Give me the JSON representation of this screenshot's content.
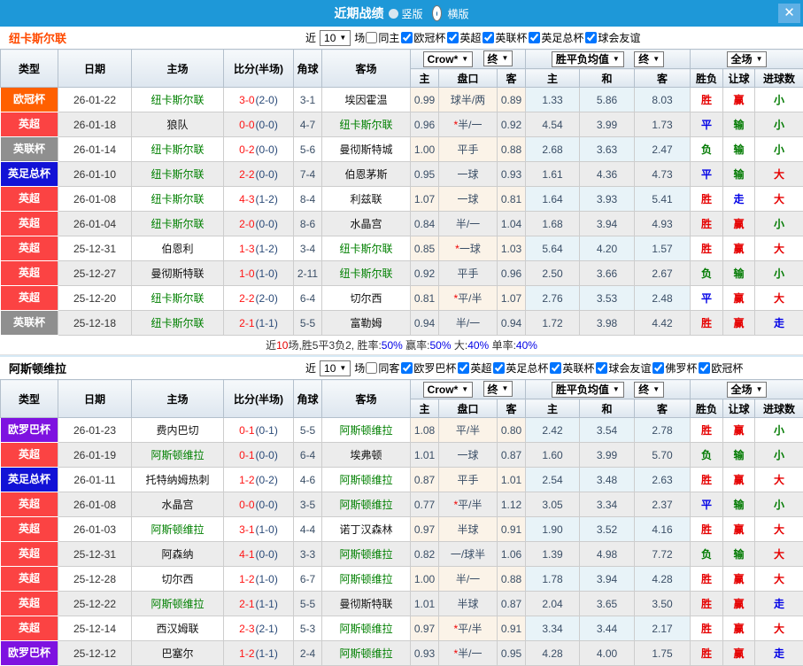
{
  "titlebar": {
    "title": "近期战绩",
    "radio_vertical": "竖版",
    "radio_horizontal": "横版",
    "close": "✕"
  },
  "header": {
    "cols": [
      "类型",
      "日期",
      "主场",
      "比分(半场)",
      "角球",
      "客场"
    ],
    "sub": [
      "主",
      "盘口",
      "客",
      "主",
      "和",
      "客",
      "胜负",
      "让球",
      "进球数"
    ],
    "selects": {
      "bookmaker": "Crow*",
      "final_a": "终",
      "avg": "胜平负均值",
      "final_b": "终",
      "scope": "全场"
    }
  },
  "colors": {
    "titlebar_blue": "#1E98D8",
    "badge_orange": "#FF6000",
    "badge_red": "#FB4343",
    "badge_gray": "#8F8F8F",
    "badge_blue": "#1212D6",
    "badge_purple": "#7E12E0",
    "highlight_team_green": "#008000",
    "score_red": "#FF1414",
    "half_score_navy": "#2A4A78",
    "win_red": "#E60000",
    "draw_blue": "#0000E6",
    "lose_green": "#007A00"
  },
  "sections": [
    {
      "team": "纽卡斯尔联",
      "team_color": "#FF4A00",
      "filters": {
        "near": "近",
        "count": "10",
        "games": "场",
        "same": "同主",
        "same_checked": false,
        "leagues": [
          "欧冠杯",
          "英超",
          "英联杯",
          "英足总杯",
          "球会友谊"
        ]
      },
      "rows": [
        {
          "comp": "欧冠杯",
          "badge": "orange",
          "date": "26-01-22",
          "home": "纽卡斯尔联",
          "hh": true,
          "score": "3-0",
          "half": "(2-0)",
          "corner": "3-1",
          "away": "埃因霍温",
          "ah": false,
          "w1": "0.99",
          "pk": "球半/两",
          "star": false,
          "w2": "0.89",
          "m1": "1.33",
          "m2": "5.86",
          "m3": "8.03",
          "r1": "胜",
          "c1": "r",
          "r2": "赢",
          "c2": "r",
          "r3": "小",
          "c3": "g"
        },
        {
          "comp": "英超",
          "badge": "red",
          "date": "26-01-18",
          "home": "狼队",
          "hh": false,
          "score": "0-0",
          "half": "(0-0)",
          "corner": "4-7",
          "away": "纽卡斯尔联",
          "ah": true,
          "w1": "0.96",
          "pk": "半/一",
          "star": true,
          "w2": "0.92",
          "m1": "4.54",
          "m2": "3.99",
          "m3": "1.73",
          "r1": "平",
          "c1": "b",
          "r2": "输",
          "c2": "g",
          "r3": "小",
          "c3": "g"
        },
        {
          "comp": "英联杯",
          "badge": "gray",
          "date": "26-01-14",
          "home": "纽卡斯尔联",
          "hh": true,
          "score": "0-2",
          "half": "(0-0)",
          "corner": "5-6",
          "away": "曼彻斯特城",
          "ah": false,
          "w1": "1.00",
          "pk": "平手",
          "star": false,
          "w2": "0.88",
          "m1": "2.68",
          "m2": "3.63",
          "m3": "2.47",
          "r1": "负",
          "c1": "g",
          "r2": "输",
          "c2": "g",
          "r3": "小",
          "c3": "g"
        },
        {
          "comp": "英足总杯",
          "badge": "blue",
          "date": "26-01-10",
          "home": "纽卡斯尔联",
          "hh": true,
          "score": "2-2",
          "half": "(0-0)",
          "corner": "7-4",
          "away": "伯恩茅斯",
          "ah": false,
          "w1": "0.95",
          "pk": "一球",
          "star": false,
          "w2": "0.93",
          "m1": "1.61",
          "m2": "4.36",
          "m3": "4.73",
          "r1": "平",
          "c1": "b",
          "r2": "输",
          "c2": "g",
          "r3": "大",
          "c3": "r"
        },
        {
          "comp": "英超",
          "badge": "red",
          "date": "26-01-08",
          "home": "纽卡斯尔联",
          "hh": true,
          "score": "4-3",
          "half": "(1-2)",
          "corner": "8-4",
          "away": "利兹联",
          "ah": false,
          "w1": "1.07",
          "pk": "一球",
          "star": false,
          "w2": "0.81",
          "m1": "1.64",
          "m2": "3.93",
          "m3": "5.41",
          "r1": "胜",
          "c1": "r",
          "r2": "走",
          "c2": "b",
          "r3": "大",
          "c3": "r"
        },
        {
          "comp": "英超",
          "badge": "red",
          "date": "26-01-04",
          "home": "纽卡斯尔联",
          "hh": true,
          "score": "2-0",
          "half": "(0-0)",
          "corner": "8-6",
          "away": "水晶宫",
          "ah": false,
          "w1": "0.84",
          "pk": "半/一",
          "star": false,
          "w2": "1.04",
          "m1": "1.68",
          "m2": "3.94",
          "m3": "4.93",
          "r1": "胜",
          "c1": "r",
          "r2": "赢",
          "c2": "r",
          "r3": "小",
          "c3": "g"
        },
        {
          "comp": "英超",
          "badge": "red",
          "date": "25-12-31",
          "home": "伯恩利",
          "hh": false,
          "score": "1-3",
          "half": "(1-2)",
          "corner": "3-4",
          "away": "纽卡斯尔联",
          "ah": true,
          "w1": "0.85",
          "pk": "一球",
          "star": true,
          "w2": "1.03",
          "m1": "5.64",
          "m2": "4.20",
          "m3": "1.57",
          "r1": "胜",
          "c1": "r",
          "r2": "赢",
          "c2": "r",
          "r3": "大",
          "c3": "r"
        },
        {
          "comp": "英超",
          "badge": "red",
          "date": "25-12-27",
          "home": "曼彻斯特联",
          "hh": false,
          "score": "1-0",
          "half": "(1-0)",
          "corner": "2-11",
          "away": "纽卡斯尔联",
          "ah": true,
          "w1": "0.92",
          "pk": "平手",
          "star": false,
          "w2": "0.96",
          "m1": "2.50",
          "m2": "3.66",
          "m3": "2.67",
          "r1": "负",
          "c1": "g",
          "r2": "输",
          "c2": "g",
          "r3": "小",
          "c3": "g"
        },
        {
          "comp": "英超",
          "badge": "red",
          "date": "25-12-20",
          "home": "纽卡斯尔联",
          "hh": true,
          "score": "2-2",
          "half": "(2-0)",
          "corner": "6-4",
          "away": "切尔西",
          "ah": false,
          "w1": "0.81",
          "pk": "平/半",
          "star": true,
          "w2": "1.07",
          "m1": "2.76",
          "m2": "3.53",
          "m3": "2.48",
          "r1": "平",
          "c1": "b",
          "r2": "赢",
          "c2": "r",
          "r3": "大",
          "c3": "r"
        },
        {
          "comp": "英联杯",
          "badge": "gray",
          "date": "25-12-18",
          "home": "纽卡斯尔联",
          "hh": true,
          "score": "2-1",
          "half": "(1-1)",
          "corner": "5-5",
          "away": "富勒姆",
          "ah": false,
          "w1": "0.94",
          "pk": "半/一",
          "star": false,
          "w2": "0.94",
          "m1": "1.72",
          "m2": "3.98",
          "m3": "4.42",
          "r1": "胜",
          "c1": "r",
          "r2": "赢",
          "c2": "r",
          "r3": "走",
          "c3": "b"
        }
      ],
      "summary": [
        {
          "t": "近"
        },
        {
          "t": "10",
          "c": "r"
        },
        {
          "t": "场,胜5平3负2, 胜率:"
        },
        {
          "t": "50%",
          "c": "b"
        },
        {
          "t": " 赢率:"
        },
        {
          "t": "50%",
          "c": "b"
        },
        {
          "t": " 大:"
        },
        {
          "t": "40%",
          "c": "b"
        },
        {
          "t": " 单率:"
        },
        {
          "t": "40%",
          "c": "b"
        }
      ]
    },
    {
      "team": "阿斯顿维拉",
      "team_color": "#000000",
      "filters": {
        "near": "近",
        "count": "10",
        "games": "场",
        "same": "同客",
        "same_checked": false,
        "leagues": [
          "欧罗巴杯",
          "英超",
          "英足总杯",
          "英联杯",
          "球会友谊",
          "佛罗杯",
          "欧冠杯"
        ]
      },
      "rows": [
        {
          "comp": "欧罗巴杯",
          "badge": "purple",
          "date": "26-01-23",
          "home": "费内巴切",
          "hh": false,
          "score": "0-1",
          "half": "(0-1)",
          "corner": "5-5",
          "away": "阿斯顿维拉",
          "ah": true,
          "w1": "1.08",
          "pk": "平/半",
          "star": false,
          "w2": "0.80",
          "m1": "2.42",
          "m2": "3.54",
          "m3": "2.78",
          "r1": "胜",
          "c1": "r",
          "r2": "赢",
          "c2": "r",
          "r3": "小",
          "c3": "g"
        },
        {
          "comp": "英超",
          "badge": "red",
          "date": "26-01-19",
          "home": "阿斯顿维拉",
          "hh": true,
          "score": "0-1",
          "half": "(0-0)",
          "corner": "6-4",
          "away": "埃弗顿",
          "ah": false,
          "w1": "1.01",
          "pk": "一球",
          "star": false,
          "w2": "0.87",
          "m1": "1.60",
          "m2": "3.99",
          "m3": "5.70",
          "r1": "负",
          "c1": "g",
          "r2": "输",
          "c2": "g",
          "r3": "小",
          "c3": "g"
        },
        {
          "comp": "英足总杯",
          "badge": "blue",
          "date": "26-01-11",
          "home": "托特纳姆热刺",
          "hh": false,
          "score": "1-2",
          "half": "(0-2)",
          "corner": "4-6",
          "away": "阿斯顿维拉",
          "ah": true,
          "w1": "0.87",
          "pk": "平手",
          "star": false,
          "w2": "1.01",
          "m1": "2.54",
          "m2": "3.48",
          "m3": "2.63",
          "r1": "胜",
          "c1": "r",
          "r2": "赢",
          "c2": "r",
          "r3": "大",
          "c3": "r"
        },
        {
          "comp": "英超",
          "badge": "red",
          "date": "26-01-08",
          "home": "水晶宫",
          "hh": false,
          "score": "0-0",
          "half": "(0-0)",
          "corner": "3-5",
          "away": "阿斯顿维拉",
          "ah": true,
          "w1": "0.77",
          "pk": "平/半",
          "star": true,
          "w2": "1.12",
          "m1": "3.05",
          "m2": "3.34",
          "m3": "2.37",
          "r1": "平",
          "c1": "b",
          "r2": "输",
          "c2": "g",
          "r3": "小",
          "c3": "g"
        },
        {
          "comp": "英超",
          "badge": "red",
          "date": "26-01-03",
          "home": "阿斯顿维拉",
          "hh": true,
          "score": "3-1",
          "half": "(1-0)",
          "corner": "4-4",
          "away": "诺丁汉森林",
          "ah": false,
          "w1": "0.97",
          "pk": "半球",
          "star": false,
          "w2": "0.91",
          "m1": "1.90",
          "m2": "3.52",
          "m3": "4.16",
          "r1": "胜",
          "c1": "r",
          "r2": "赢",
          "c2": "r",
          "r3": "大",
          "c3": "r"
        },
        {
          "comp": "英超",
          "badge": "red",
          "date": "25-12-31",
          "home": "阿森纳",
          "hh": false,
          "score": "4-1",
          "half": "(0-0)",
          "corner": "3-3",
          "away": "阿斯顿维拉",
          "ah": true,
          "w1": "0.82",
          "pk": "一/球半",
          "star": false,
          "w2": "1.06",
          "m1": "1.39",
          "m2": "4.98",
          "m3": "7.72",
          "r1": "负",
          "c1": "g",
          "r2": "输",
          "c2": "g",
          "r3": "大",
          "c3": "r"
        },
        {
          "comp": "英超",
          "badge": "red",
          "date": "25-12-28",
          "home": "切尔西",
          "hh": false,
          "score": "1-2",
          "half": "(1-0)",
          "corner": "6-7",
          "away": "阿斯顿维拉",
          "ah": true,
          "w1": "1.00",
          "pk": "半/一",
          "star": false,
          "w2": "0.88",
          "m1": "1.78",
          "m2": "3.94",
          "m3": "4.28",
          "r1": "胜",
          "c1": "r",
          "r2": "赢",
          "c2": "r",
          "r3": "大",
          "c3": "r"
        },
        {
          "comp": "英超",
          "badge": "red",
          "date": "25-12-22",
          "home": "阿斯顿维拉",
          "hh": true,
          "score": "2-1",
          "half": "(1-1)",
          "corner": "5-5",
          "away": "曼彻斯特联",
          "ah": false,
          "w1": "1.01",
          "pk": "半球",
          "star": false,
          "w2": "0.87",
          "m1": "2.04",
          "m2": "3.65",
          "m3": "3.50",
          "r1": "胜",
          "c1": "r",
          "r2": "赢",
          "c2": "r",
          "r3": "走",
          "c3": "b"
        },
        {
          "comp": "英超",
          "badge": "red",
          "date": "25-12-14",
          "home": "西汉姆联",
          "hh": false,
          "score": "2-3",
          "half": "(2-1)",
          "corner": "5-3",
          "away": "阿斯顿维拉",
          "ah": true,
          "w1": "0.97",
          "pk": "平/半",
          "star": true,
          "w2": "0.91",
          "m1": "3.34",
          "m2": "3.44",
          "m3": "2.17",
          "r1": "胜",
          "c1": "r",
          "r2": "赢",
          "c2": "r",
          "r3": "大",
          "c3": "r"
        },
        {
          "comp": "欧罗巴杯",
          "badge": "purple",
          "date": "25-12-12",
          "home": "巴塞尔",
          "hh": false,
          "score": "1-2",
          "half": "(1-1)",
          "corner": "2-4",
          "away": "阿斯顿维拉",
          "ah": true,
          "w1": "0.93",
          "pk": "半/一",
          "star": true,
          "w2": "0.95",
          "m1": "4.28",
          "m2": "4.00",
          "m3": "1.75",
          "r1": "胜",
          "c1": "r",
          "r2": "赢",
          "c2": "r",
          "r3": "走",
          "c3": "b"
        }
      ],
      "summary": []
    }
  ]
}
